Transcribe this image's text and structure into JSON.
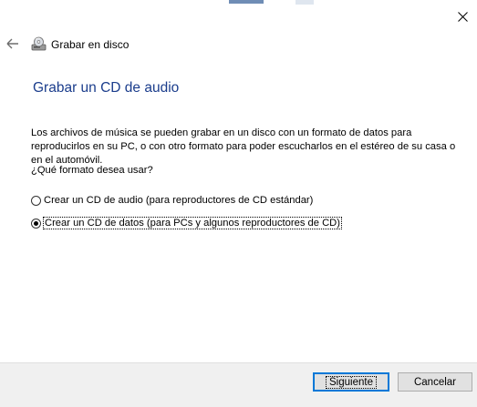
{
  "wizard": {
    "title": "Grabar en disco",
    "main_instruction": "Grabar un CD de audio",
    "description": "Los archivos de música se pueden grabar en un disco con un formato de datos para reproducirlos en su PC, o con otro formato para poder escucharlos en el estéreo de su casa o en el automóvil.",
    "question": "¿Qué formato desea usar?"
  },
  "options": [
    {
      "label": "Crear un CD de audio (para reproductores de CD estándar)",
      "selected": false
    },
    {
      "label": "Crear un CD de datos (para PCs y algunos reproductores de CD)",
      "selected": true
    }
  ],
  "buttons": {
    "next_label": "Siguiente",
    "cancel_label": "Cancelar"
  },
  "icons": {
    "close": "close-icon",
    "back": "back-arrow-icon",
    "disc": "disc-burner-icon"
  },
  "colors": {
    "instruction": "#1b3d8c",
    "default_button_border": "#0078d7",
    "footer_bg": "#f0f0f0"
  }
}
